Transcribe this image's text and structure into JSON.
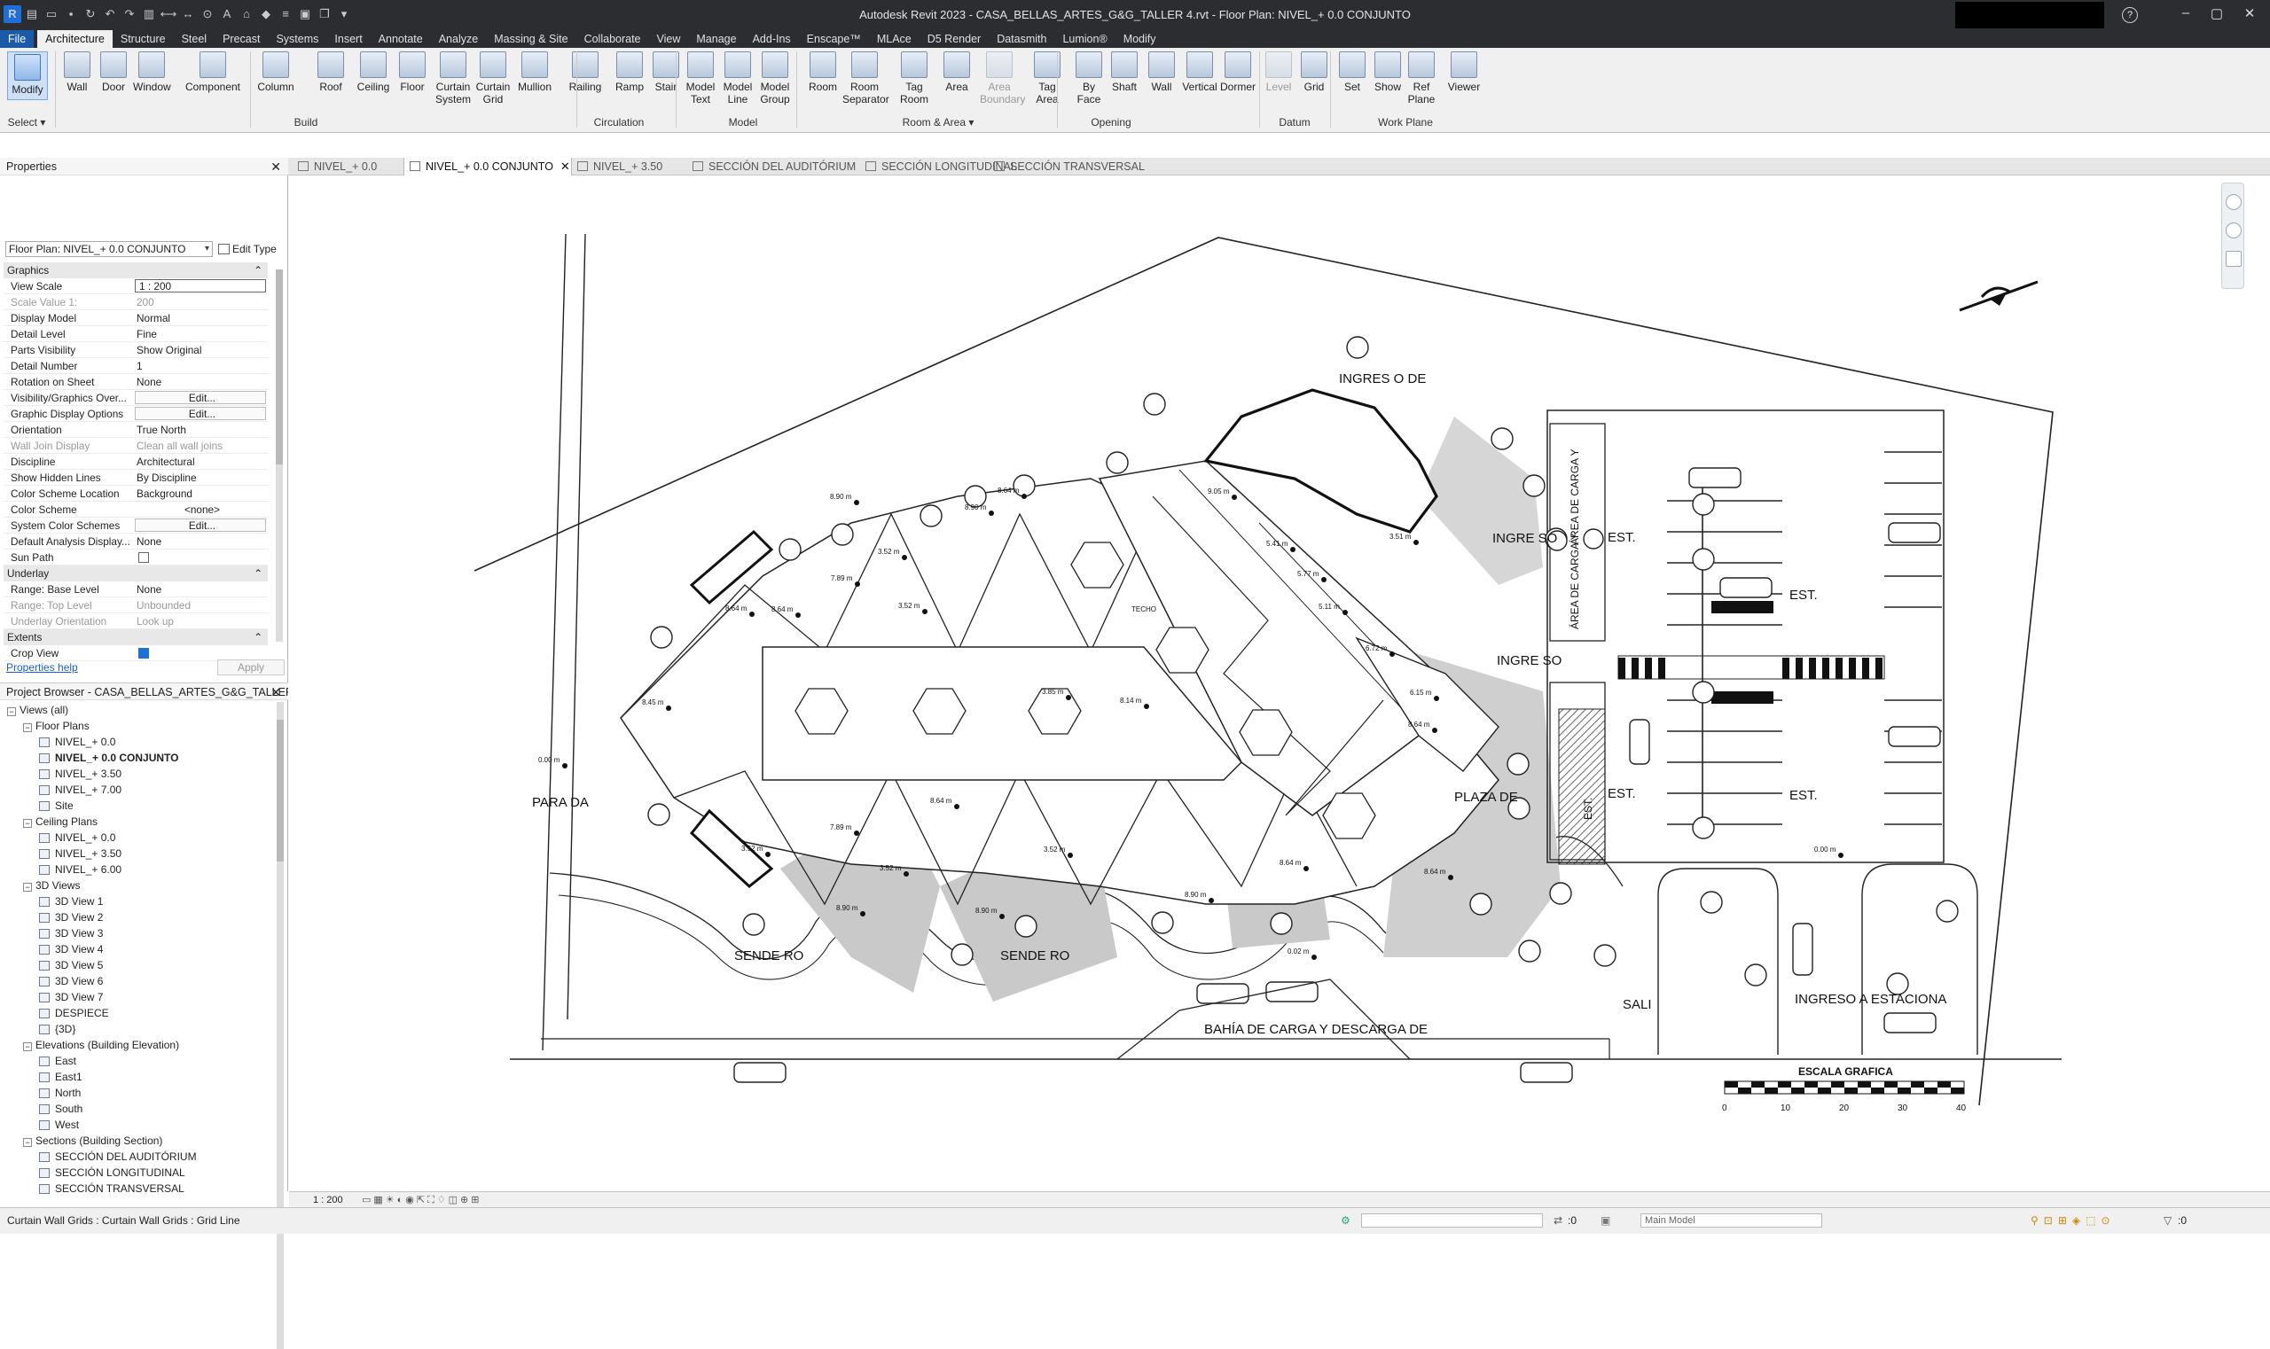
{
  "app": {
    "title": "Autodesk Revit 2023 - CASA_BELLAS_ARTES_G&G_TALLER 4.rvt - Floor Plan: NIVEL_+ 0.0 CONJUNTO",
    "help": "?",
    "controls": {
      "minimize": "–",
      "maximize": "▢",
      "close": "✕"
    }
  },
  "menu_tabs": [
    "File",
    "Architecture",
    "Structure",
    "Steel",
    "Precast",
    "Systems",
    "Insert",
    "Annotate",
    "Analyze",
    "Massing & Site",
    "Collaborate",
    "View",
    "Manage",
    "Add-Ins",
    "Enscape™",
    "MLAce",
    "D5 Render",
    "Datasmith",
    "Lumion®",
    "Modify"
  ],
  "ribbon": {
    "buttons": [
      {
        "label": "Modify",
        "icon": "modify-arrow-icon"
      },
      {
        "label": "Wall",
        "icon": "wall-icon"
      },
      {
        "label": "Door",
        "icon": "door-icon"
      },
      {
        "label": "Window",
        "icon": "window-icon"
      },
      {
        "label": "Component",
        "icon": "component-icon"
      },
      {
        "label": "Column",
        "icon": "column-icon"
      },
      {
        "label": "Roof",
        "icon": "roof-icon"
      },
      {
        "label": "Ceiling",
        "icon": "ceiling-icon"
      },
      {
        "label": "Floor",
        "icon": "floor-icon"
      },
      {
        "label": "Curtain System",
        "icon": "curtain-system-icon"
      },
      {
        "label": "Curtain Grid",
        "icon": "curtain-grid-icon"
      },
      {
        "label": "Mullion",
        "icon": "mullion-icon"
      },
      {
        "label": "Railing",
        "icon": "railing-icon"
      },
      {
        "label": "Ramp",
        "icon": "ramp-icon"
      },
      {
        "label": "Stair",
        "icon": "stair-icon"
      },
      {
        "label": "Model Text",
        "icon": "model-text-icon"
      },
      {
        "label": "Model Line",
        "icon": "model-line-icon"
      },
      {
        "label": "Model Group",
        "icon": "model-group-icon"
      },
      {
        "label": "Room",
        "icon": "room-icon"
      },
      {
        "label": "Room Separator",
        "icon": "room-separator-icon"
      },
      {
        "label": "Tag Room",
        "icon": "tag-room-icon"
      },
      {
        "label": "Area",
        "icon": "area-icon"
      },
      {
        "label": "Area Boundary",
        "icon": "area-boundary-icon"
      },
      {
        "label": "Tag Area",
        "icon": "tag-area-icon"
      },
      {
        "label": "By Face",
        "icon": "by-face-icon"
      },
      {
        "label": "Shaft",
        "icon": "shaft-icon"
      },
      {
        "label": "Wall",
        "icon": "wall-opening-icon"
      },
      {
        "label": "Vertical",
        "icon": "vertical-opening-icon"
      },
      {
        "label": "Dormer",
        "icon": "dormer-icon"
      },
      {
        "label": "Level",
        "icon": "level-icon"
      },
      {
        "label": "Grid",
        "icon": "grid-icon"
      },
      {
        "label": "Set",
        "icon": "set-workplane-icon"
      },
      {
        "label": "Show",
        "icon": "show-workplane-icon"
      },
      {
        "label": "Ref Plane",
        "icon": "ref-plane-icon"
      },
      {
        "label": "Viewer",
        "icon": "viewer-icon"
      }
    ],
    "panels": [
      "Select ▾",
      "Build",
      "Circulation",
      "Model",
      "Room & Area ▾",
      "Opening",
      "Datum",
      "Work Plane"
    ]
  },
  "view_tabs": [
    {
      "label": "NIVEL_+ 0.0"
    },
    {
      "label": "NIVEL_+ 0.0 CONJUNTO",
      "close": "✕"
    },
    {
      "label": "NIVEL_+ 3.50"
    },
    {
      "label": "SECCIÓN DEL AUDITÓRIUM"
    },
    {
      "label": "SECCIÓN LONGITUDINAL"
    },
    {
      "label": "SECCIÓN TRANSVERSAL"
    }
  ],
  "properties": {
    "title": "Properties",
    "close": "✕",
    "type_selector": "Floor Plan: NIVEL_+ 0.0 CONJUNTO",
    "edit_type": "Edit Type",
    "categories": {
      "graphics": "Graphics",
      "underlay": "Underlay",
      "extents": "Extents"
    },
    "rows": [
      {
        "k": "View Scale",
        "v": "1 : 200"
      },
      {
        "k": "Scale Value    1:",
        "v": "200"
      },
      {
        "k": "Display Model",
        "v": "Normal"
      },
      {
        "k": "Detail Level",
        "v": "Fine"
      },
      {
        "k": "Parts Visibility",
        "v": "Show Original"
      },
      {
        "k": "Detail Number",
        "v": "1"
      },
      {
        "k": "Rotation on Sheet",
        "v": "None"
      },
      {
        "k": "Visibility/Graphics Over...",
        "v": "Edit..."
      },
      {
        "k": "Graphic Display Options",
        "v": "Edit..."
      },
      {
        "k": "Orientation",
        "v": "True North"
      },
      {
        "k": "Wall Join Display",
        "v": "Clean all wall joins"
      },
      {
        "k": "Discipline",
        "v": "Architectural"
      },
      {
        "k": "Show Hidden Lines",
        "v": "By Discipline"
      },
      {
        "k": "Color Scheme Location",
        "v": "Background"
      },
      {
        "k": "Color Scheme",
        "v": "<none>"
      },
      {
        "k": "System Color Schemes",
        "v": "Edit..."
      },
      {
        "k": "Default Analysis Display...",
        "v": "None"
      },
      {
        "k": "Sun Path",
        "v": ""
      },
      {
        "k": "Range: Base Level",
        "v": "None"
      },
      {
        "k": "Range: Top Level",
        "v": "Unbounded"
      },
      {
        "k": "Underlay Orientation",
        "v": "Look up"
      },
      {
        "k": "Crop View",
        "v": ""
      }
    ],
    "help_link": "Properties help",
    "apply": "Apply"
  },
  "project_browser": {
    "title": "Project Browser - CASA_BELLAS_ARTES_G&G_TALLER 4....",
    "close": "✕",
    "nodes": [
      {
        "label": "Views (all)",
        "level": 0,
        "toggle": "−"
      },
      {
        "label": "Floor Plans",
        "level": 1,
        "toggle": "−"
      },
      {
        "label": "NIVEL_+ 0.0",
        "level": 2
      },
      {
        "label": "NIVEL_+ 0.0 CONJUNTO",
        "level": 2,
        "bold": true
      },
      {
        "label": "NIVEL_+ 3.50",
        "level": 2
      },
      {
        "label": "NIVEL_+ 7.00",
        "level": 2
      },
      {
        "label": "Site",
        "level": 2
      },
      {
        "label": "Ceiling Plans",
        "level": 1,
        "toggle": "−"
      },
      {
        "label": "NIVEL_+ 0.0",
        "level": 2
      },
      {
        "label": "NIVEL_+ 3.50",
        "level": 2
      },
      {
        "label": "NIVEL_+ 6.00",
        "level": 2
      },
      {
        "label": "3D Views",
        "level": 1,
        "toggle": "−"
      },
      {
        "label": "3D View 1",
        "level": 2
      },
      {
        "label": "3D View 2",
        "level": 2
      },
      {
        "label": "3D View 3",
        "level": 2
      },
      {
        "label": "3D View 4",
        "level": 2
      },
      {
        "label": "3D View 5",
        "level": 2
      },
      {
        "label": "3D View 6",
        "level": 2
      },
      {
        "label": "3D View 7",
        "level": 2
      },
      {
        "label": "DESPIECE",
        "level": 2
      },
      {
        "label": "{3D}",
        "level": 2
      },
      {
        "label": "Elevations (Building Elevation)",
        "level": 1,
        "toggle": "−"
      },
      {
        "label": "East",
        "level": 2
      },
      {
        "label": "East1",
        "level": 2
      },
      {
        "label": "North",
        "level": 2
      },
      {
        "label": "South",
        "level": 2
      },
      {
        "label": "West",
        "level": 2
      },
      {
        "label": "Sections (Building Section)",
        "level": 1,
        "toggle": "−"
      },
      {
        "label": "SECCIÓN DEL AUDITÓRIUM",
        "level": 2
      },
      {
        "label": "SECCIÓN LONGITUDINAL",
        "level": 2
      },
      {
        "label": "SECCIÓN TRANSVERSAL",
        "level": 2
      }
    ]
  },
  "drawing": {
    "labels": {
      "ingreso_top": "INGRES O DE",
      "ingreso_right": "INGRE SO",
      "ingreso_mid": "INGRE SO",
      "parada": "PARA DA",
      "plaza": "PLAZA DE",
      "sendero_left": "SENDE RO",
      "sendero_right": "SENDE RO",
      "bahia": "BAHÍA DE CARGA Y DESCARGA DE",
      "salida": "SALI",
      "ingreso_estac": "INGRESO A ESTACIONA",
      "area_carga_1": "ÁREA DE CARGA Y",
      "area_carga_2": "ÁREA DE CARGA Y",
      "est_a": "EST.",
      "est_b": "EST.",
      "est_c": "EST.",
      "est_d": "EST.",
      "est_e": "EST.",
      "techo": "TECHO",
      "escala": "ESCALA GRAFICA"
    },
    "scale_ticks": [
      "0",
      "10",
      "20",
      "30",
      "40"
    ],
    "levels": [
      "8.90 m",
      "8.64 m",
      "8.90 m",
      "3.52 m",
      "7.89 m",
      "8.64 m",
      "3.52 m",
      "8.64 m",
      "3.85 m",
      "8.45 m",
      "8.14 m",
      "9.05 m",
      "5.41 m",
      "5.77 m",
      "5.11 m",
      "6.72 m",
      "6.15 m",
      "8.64 m",
      "3.51 m",
      "3.52 m",
      "8.64 m",
      "7.89 m",
      "8.90 m",
      "3.52 m",
      "3.52 m",
      "8.90 m",
      "8.64 m",
      "8.90 m",
      "8.64 m",
      "0.00 m",
      "0.02 m",
      "0.00 m"
    ]
  },
  "view_control_bar": {
    "scale": "1 : 200"
  },
  "status": {
    "message": "Curtain Wall Grids : Curtain Wall Grids : Grid Line",
    "zero": ":0",
    "model": "Main Model",
    "filter": ":0"
  }
}
